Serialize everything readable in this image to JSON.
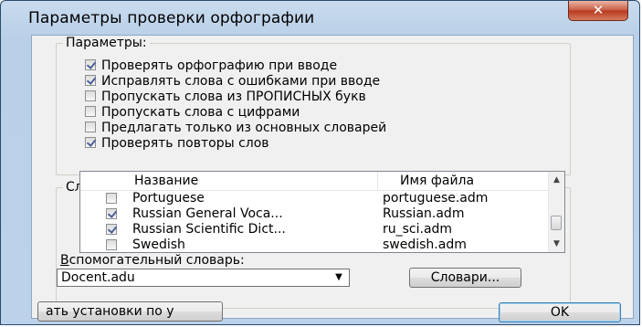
{
  "window": {
    "title": "Параметры проверки орфографии",
    "close_symbol": "✕"
  },
  "options": {
    "legend": "Параметры:",
    "items": [
      {
        "label": "Проверять орфографию при вводе",
        "checked": true
      },
      {
        "label": "Исправлять слова с ошибками при вводе",
        "checked": true
      },
      {
        "label": "Пропускать слова из ПРОПИСНЫХ букв",
        "checked": false
      },
      {
        "label": "Пропускать слова с цифрами",
        "checked": false
      },
      {
        "label": "Предлагать только из основных словарей",
        "checked": false
      },
      {
        "label": "Проверять повторы слов",
        "checked": true
      }
    ]
  },
  "dictionaries": {
    "legend": "Словари:",
    "columns": {
      "name": "Название",
      "file": "Имя файла"
    },
    "rows": [
      {
        "name": "Portuguese",
        "file": "portuguese.adm",
        "checked": false
      },
      {
        "name": "Russian General Voca...",
        "file": "Russian.adm",
        "checked": true
      },
      {
        "name": "Russian Scientific Dict...",
        "file": "ru_sci.adm",
        "checked": true
      },
      {
        "name": "Swedish",
        "file": "swedish.adm",
        "checked": false
      }
    ]
  },
  "aux": {
    "label": "Вспомогательный словарь:",
    "label_underlined": "В",
    "label_rest": "спомогательный словарь:",
    "value": "Docent.adu"
  },
  "buttons": {
    "dictionaries": "Словари...",
    "reset": "ать установки по у",
    "ok": "OK"
  }
}
